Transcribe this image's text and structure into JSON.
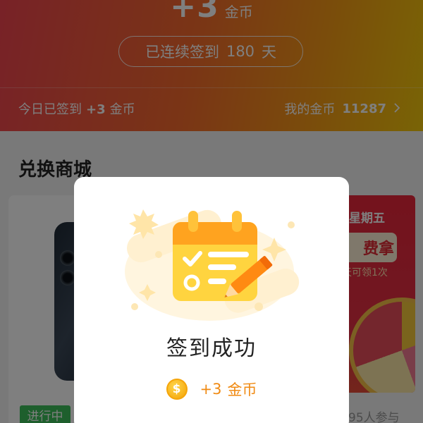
{
  "header": {
    "big_coins": "+3",
    "big_coins_unit": "金币",
    "streak_prefix": "已连续签到",
    "streak_days": "180",
    "streak_suffix": "天",
    "today_prefix": "今日已签到",
    "today_amount": "+3",
    "today_unit": "金币",
    "mycoins_label": "我的金币",
    "mycoins_value": "11287"
  },
  "mall": {
    "title": "兑换商城",
    "left_card": {
      "status": "进行中"
    },
    "right_card": {
      "line1": "星期五",
      "line2": "费拿",
      "line3": "天可领1次",
      "participants": "95人参与"
    }
  },
  "modal": {
    "title": "签到成功",
    "reward_amount": "+3",
    "reward_unit": "金币",
    "coin_symbol": "$"
  },
  "colors": {
    "header_start": "#f0444f",
    "header_end": "#f3c80b",
    "reward_orange": "#f08a12",
    "status_green": "#3dbf5a"
  }
}
